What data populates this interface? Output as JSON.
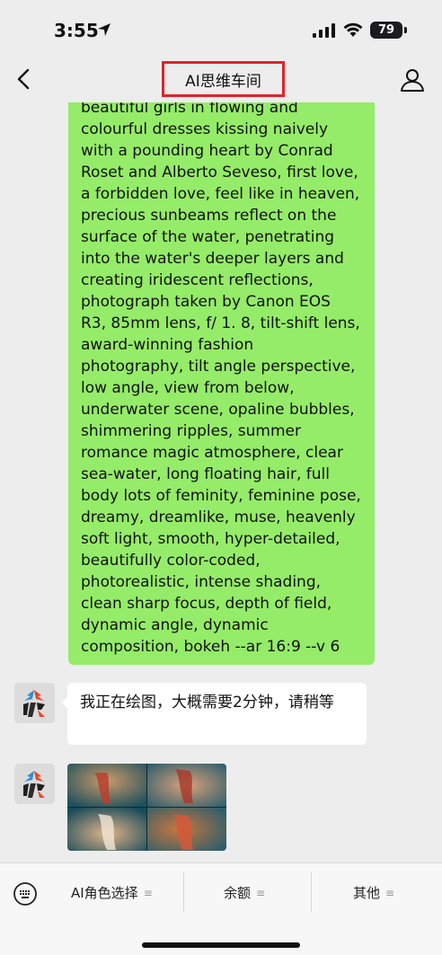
{
  "status_bar": {
    "time": "3:55",
    "battery": "79"
  },
  "nav": {
    "title": "AI思维车间",
    "highlight_color": "#e0242a"
  },
  "messages": {
    "sent_text": "beautiful girls in flowing and\ncolourful dresses kissing naively\nwith a pounding heart by Conrad\nRoset and Alberto Seveso, first love,\n a forbidden love, feel like in heaven,\n precious sunbeams reflect on the\nsurface of the water, penetrating\ninto the water's deeper layers and\ncreating iridescent reflections,\nphotograph taken by Canon EOS\nR3, 85mm lens, f/ 1. 8, tilt-shift lens,\n award-winning fashion\nphotography, tilt angle perspective,\nlow angle, view from below,\nunderwater scene, opaline bubbles,\n shimmering ripples, summer\nromance magic atmosphere, clear\nsea-water, long floating hair, full\nbody lots of feminity, feminine pose,\n dreamy, dreamlike, muse, heavenly\nsoft light, smooth, hyper-detailed,\nbeautifully color-coded,\nphotorealistic, intense shading,\nclean sharp focus, depth of field,\ndynamic angle, dynamic\ncomposition, bokeh --ar 16:9 --v 6",
    "received_text": "我正在绘图，大概需要2分钟，请稍等",
    "sent_bubble_color": "#95ec69"
  },
  "bottom_menu": {
    "items": [
      {
        "label": "AI角色选择"
      },
      {
        "label": "余额"
      },
      {
        "label": "其他"
      }
    ],
    "lines_glyph": "≡"
  },
  "icons": [
    "location-arrow-icon",
    "signal-icon",
    "wifi-icon",
    "battery-icon",
    "back-chevron-icon",
    "person-icon",
    "keyboard-icon",
    "bot-avatar-icon"
  ]
}
